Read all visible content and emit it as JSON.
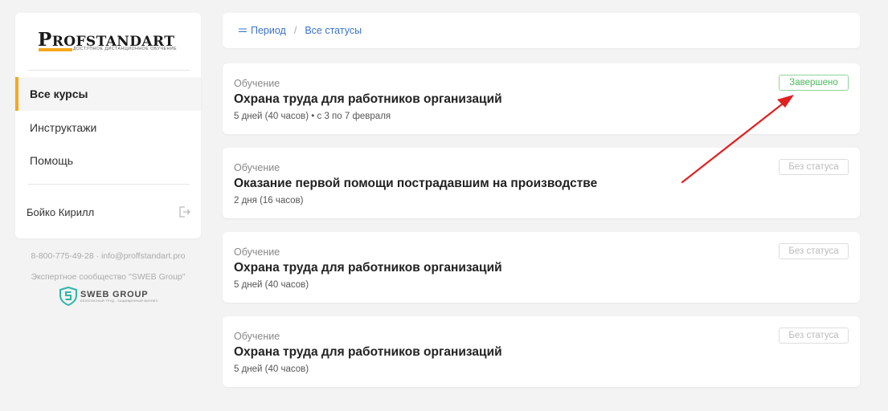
{
  "brand": {
    "name_initial": "P",
    "name_rest": "ROFSTANDART",
    "tagline": "Доступное дистанционное обучение"
  },
  "sidebar": {
    "items": [
      {
        "label": "Все курсы",
        "active": true
      },
      {
        "label": "Инструктажи",
        "active": false
      },
      {
        "label": "Помощь",
        "active": false
      }
    ],
    "user": {
      "name": "Бойко Кирилл",
      "logout_icon": "logout-icon"
    }
  },
  "footer": {
    "contacts": "8-800-775-49-28 · info@proffstandart.pro",
    "community": "Экспертное сообщество \"SWEB Group\"",
    "partner_name": "SWEB GROUP",
    "partner_tagline": "безопасный труд - защищенный бизнес"
  },
  "filters": {
    "period_label": "Период",
    "separator": "/",
    "status_label": "Все статусы"
  },
  "courses": [
    {
      "category": "Обучение",
      "title": "Охрана труда для работников организаций",
      "meta": "5 дней (40 часов) • с 3 по 7 февраля",
      "status": "Завершено",
      "status_type": "done"
    },
    {
      "category": "Обучение",
      "title": "Оказание первой помощи пострадавшим на производстве",
      "meta": "2 дня (16 часов)",
      "status": "Без статуса",
      "status_type": "none"
    },
    {
      "category": "Обучение",
      "title": "Охрана труда для работников организаций",
      "meta": "5 дней (40 часов)",
      "status": "Без статуса",
      "status_type": "none"
    },
    {
      "category": "Обучение",
      "title": "Охрана труда для работников организаций",
      "meta": "5 дней (40 часов)",
      "status": "Без статуса",
      "status_type": "none"
    }
  ],
  "colors": {
    "accent": "#f3a81e",
    "link": "#3a72c8",
    "done": "#4db85b",
    "annotation_arrow": "#e02020"
  }
}
